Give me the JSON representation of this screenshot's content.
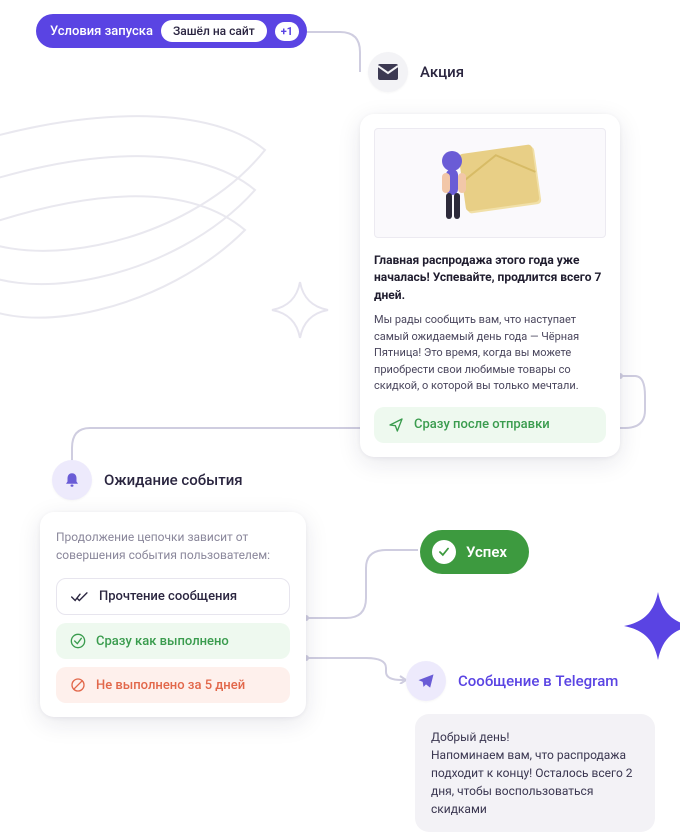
{
  "trigger": {
    "label": "Условия запуска",
    "chip": "Зашёл на сайт",
    "extra": "+1"
  },
  "promo": {
    "header": "Акция",
    "title": "Главная распродажа этого года уже началась! Успевайте, продлится всего 7 дней.",
    "body": "Мы рады сообщить вам, что наступает самый ожидаемый день года — Чёрная Пятница! Это время, когда вы можете приобрести свои любимые товары со скидкой, о которой вы только мечтали.",
    "action": "Сразу после отправки"
  },
  "wait": {
    "header": "Ожидание события",
    "description": "Продолжение цепочки зависит от совершения события пользователем:",
    "rows": {
      "read": "Прочтение сообщения",
      "done": "Сразу как выполнено",
      "fail": "Не выполнено за 5 дней"
    }
  },
  "success": {
    "label": "Успех"
  },
  "telegram": {
    "header": "Сообщение в Telegram",
    "greeting": "Добрый день!",
    "body": "Напоминаем вам, что распродажа подходит к концу! Осталось всего 2 дня, чтобы воспользоваться скидками"
  }
}
